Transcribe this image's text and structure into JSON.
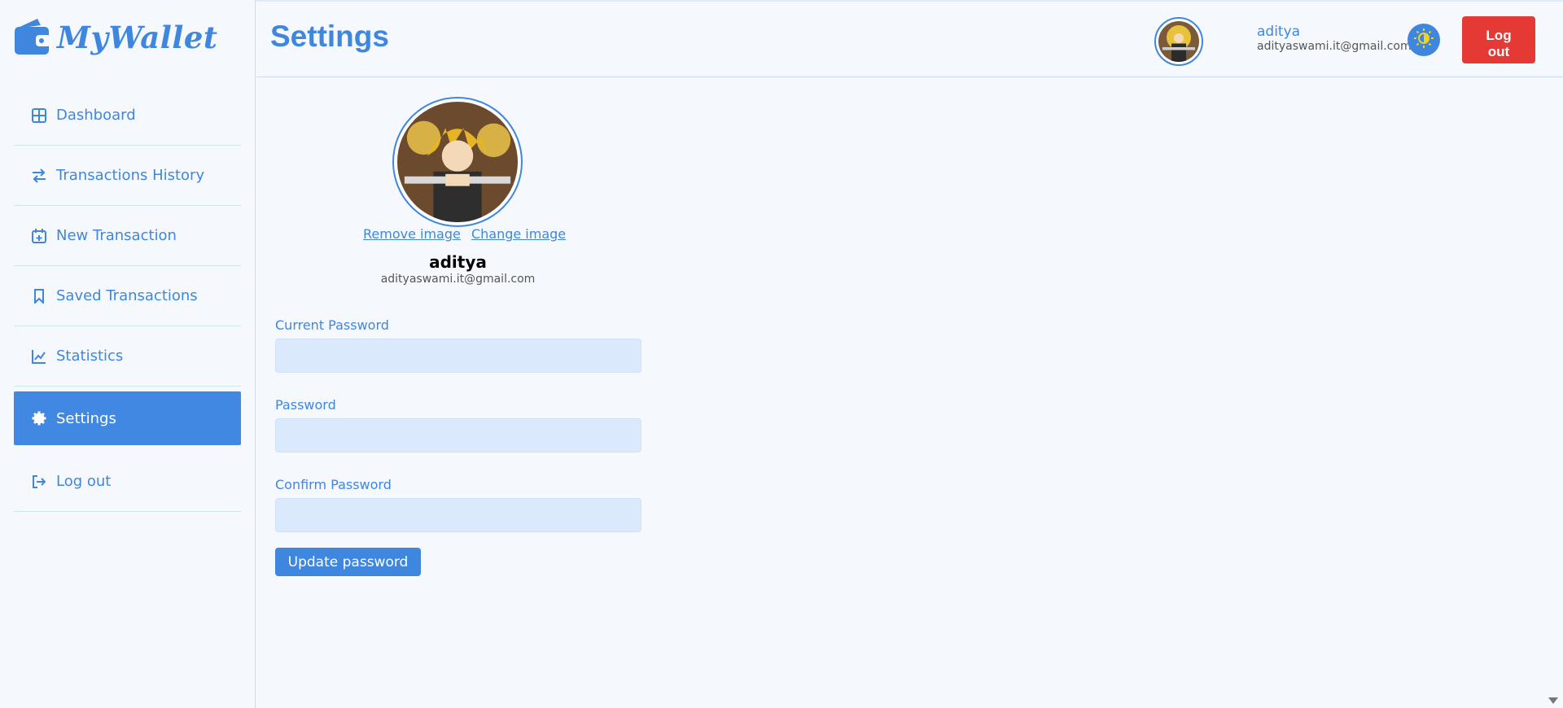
{
  "app": {
    "name": "MyWallet"
  },
  "sidebar": {
    "items": [
      {
        "label": "Dashboard",
        "icon": "grid-icon"
      },
      {
        "label": "Transactions History",
        "icon": "arrows-exchange-icon"
      },
      {
        "label": "New Transaction",
        "icon": "calendar-plus-icon"
      },
      {
        "label": "Saved Transactions",
        "icon": "bookmark-icon"
      },
      {
        "label": "Statistics",
        "icon": "chart-line-icon"
      },
      {
        "label": "Settings",
        "icon": "gear-icon",
        "active": true
      },
      {
        "label": "Log out",
        "icon": "sign-out-icon"
      }
    ]
  },
  "header": {
    "title": "Settings",
    "user_name": "aditya",
    "user_email": "adityaswami.it@gmail.com",
    "logout_label": "Log out"
  },
  "profile": {
    "remove_image": "Remove image",
    "change_image": "Change image",
    "name": "aditya",
    "email": "adityaswami.it@gmail.com"
  },
  "form": {
    "current_password_label": "Current Password",
    "current_password_value": "",
    "password_label": "Password",
    "password_value": "",
    "confirm_password_label": "Confirm Password",
    "confirm_password_value": "",
    "submit_label": "Update password"
  },
  "colors": {
    "accent": "#3f86df",
    "danger": "#e53935",
    "input_bg": "#dbe9fc",
    "page_bg": "#f5f9fe"
  }
}
